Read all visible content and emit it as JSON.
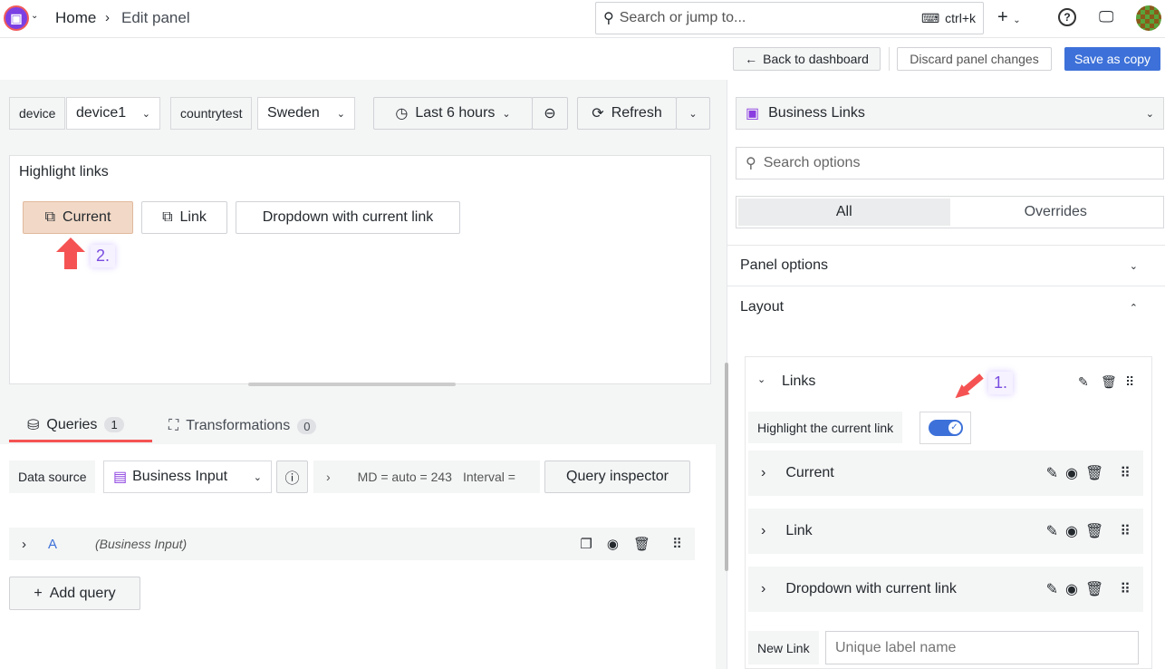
{
  "header": {
    "breadcrumb_home": "Home",
    "breadcrumb_current": "Edit panel",
    "search_placeholder": "Search or jump to...",
    "search_shortcut": "ctrl+k"
  },
  "toolbar": {
    "back": "Back to dashboard",
    "discard": "Discard panel changes",
    "save_copy": "Save as copy"
  },
  "variables": [
    {
      "label": "device",
      "value": "device1"
    },
    {
      "label": "countrytest",
      "value": "Sweden"
    }
  ],
  "time": {
    "range": "Last 6 hours",
    "refresh": "Refresh"
  },
  "panel": {
    "title": "Highlight links",
    "buttons": [
      "Current",
      "Link",
      "Dropdown with current link"
    ],
    "highlighted": "Current",
    "annotation": "2."
  },
  "query_tabs": [
    {
      "label": "Queries",
      "count": "1"
    },
    {
      "label": "Transformations",
      "count": "0"
    }
  ],
  "datasource": {
    "label": "Data source",
    "value": "Business Input",
    "md": "MD = auto = 243",
    "interval": "Interval =",
    "inspector": "Query inspector"
  },
  "query": {
    "ref": "A",
    "source": "(Business Input)",
    "add": "Add query"
  },
  "options": {
    "viz": "Business Links",
    "search_placeholder": "Search options",
    "tabs": [
      "All",
      "Overrides"
    ],
    "active_tab": "All",
    "sections": [
      "Panel options",
      "Layout"
    ],
    "links_title": "Links",
    "highlight_label": "Highlight the current link",
    "highlight_on": true,
    "annotation": "1.",
    "links": [
      "Current",
      "Link",
      "Dropdown with current link"
    ],
    "new_link_label": "New Link",
    "new_link_placeholder": "Unique label name"
  },
  "colors": {
    "accent": "#3d71d9",
    "highlight": "#f2d9c7",
    "arrow": "#f55353",
    "primary": "#3d71d9"
  }
}
